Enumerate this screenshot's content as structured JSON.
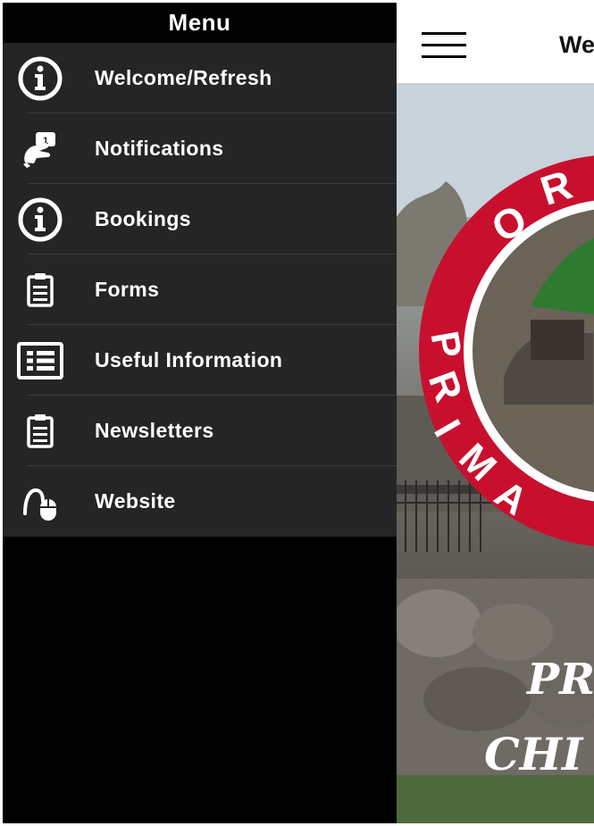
{
  "drawer": {
    "title": "Menu",
    "items": [
      {
        "label": "Welcome/Refresh",
        "icon": "info-icon"
      },
      {
        "label": "Notifications",
        "icon": "notification-icon"
      },
      {
        "label": "Bookings",
        "icon": "info-icon"
      },
      {
        "label": "Forms",
        "icon": "clipboard-icon"
      },
      {
        "label": "Useful Information",
        "icon": "list-icon"
      },
      {
        "label": "Newsletters",
        "icon": "clipboard-icon"
      },
      {
        "label": "Website",
        "icon": "mouse-icon"
      }
    ]
  },
  "app": {
    "title": "We",
    "hero_logo_text": [
      "O",
      "R",
      "P",
      "R",
      "I",
      "M",
      "A"
    ],
    "hero_caption_1": "PR",
    "hero_caption_2": "CHI"
  },
  "colors": {
    "drawer_bg": "#000000",
    "menu_bg": "#252525",
    "logo_red": "#c8102e"
  }
}
